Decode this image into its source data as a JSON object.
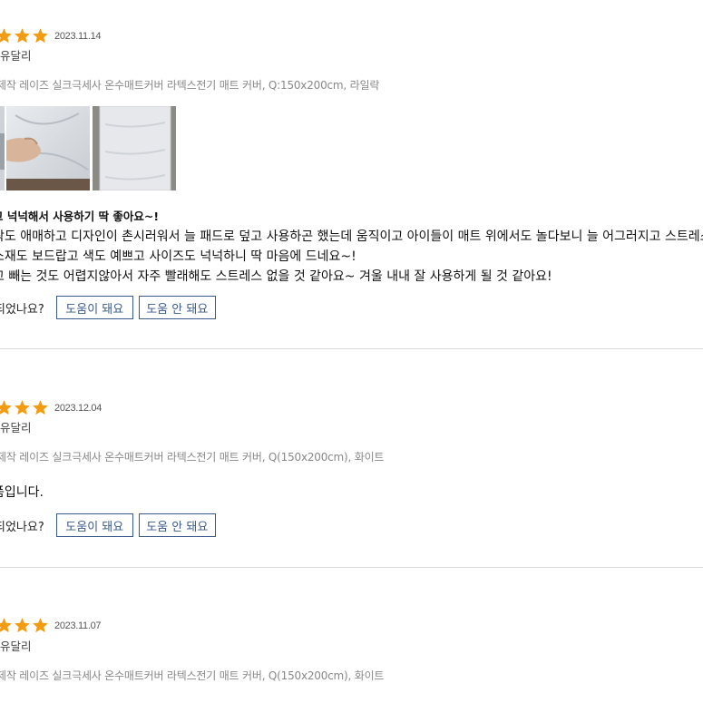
{
  "reviews": [
    {
      "rating": 3,
      "date": "2023.11.14",
      "user": "유달리",
      "option": "제작 레이즈 실크극세사 온수매트커버 라텍스전기 매트 커버, Q:150x200cm, 라일락",
      "title": "고 넉넉해서 사용하기 딱 좋아요~!",
      "body_lines": [
        "락도 애매하고 디자인이 촌시러워서 늘 패드로 덮고 사용하곤 했는데 움직이고 아이들이 매트 위에서도 놀다보니 늘 어그러지고 스트레스",
        "소재도 보드랍고 색도 예쁘고 사이즈도 넉넉하니 딱 마음에 드네요~!",
        "고 빼는 것도 어렵지않아서 자주 빨래해도 스트레스 없을 것 같아요~ 겨울 내내 잘 사용하게 될 것 같아요!"
      ],
      "helpful_question": "되었나요?",
      "helpful_yes": "도움이 돼요",
      "helpful_no": "도움 안 돼요"
    },
    {
      "rating": 3,
      "date": "2023.12.04",
      "user": "유달리",
      "option": "제작 레이즈 실크극세사 온수매트커버 라텍스전기 매트 커버, Q(150x200cm), 화이트",
      "body_lines": [
        "품입니다."
      ],
      "helpful_question": "되었나요?",
      "helpful_yes": "도움이 돼요",
      "helpful_no": "도움 안 돼요"
    },
    {
      "rating": 3,
      "date": "2023.11.07",
      "user": "유달리",
      "option": "제작 레이즈 실크극세사 온수매트커버 라텍스전기 매트 커버, Q(150x200cm), 화이트"
    }
  ],
  "colors": {
    "star": "#f39c12",
    "button_border": "#3a5a8c",
    "divider": "#d9d9d9"
  }
}
